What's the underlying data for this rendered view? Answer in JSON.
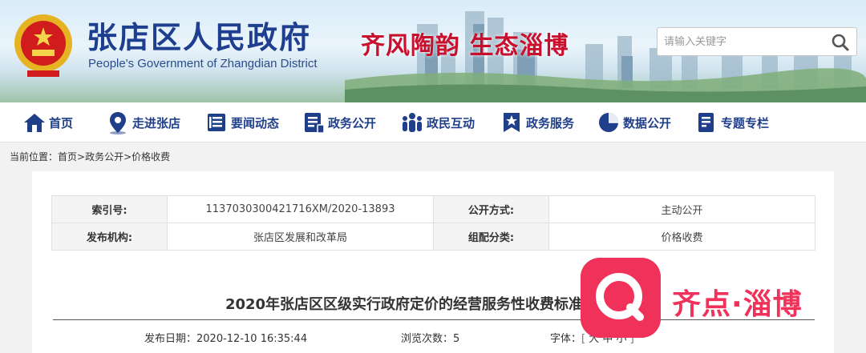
{
  "header": {
    "site_title": "张店区人民政府",
    "site_subtitle": "People's Government of Zhangdian District",
    "slogan": "齐风陶韵  生态淄博",
    "search_placeholder": "请输入关键字",
    "emblem_icon": "national-emblem-icon",
    "search_icon": "magnifier-icon"
  },
  "nav": {
    "items": [
      {
        "label": "首页",
        "icon": "home-icon"
      },
      {
        "label": "走进张店",
        "icon": "location-pin-icon"
      },
      {
        "label": "要闻动态",
        "icon": "news-icon"
      },
      {
        "label": "政务公开",
        "icon": "document-icon"
      },
      {
        "label": "政民互动",
        "icon": "people-icon"
      },
      {
        "label": "政务服务",
        "icon": "star-badge-icon"
      },
      {
        "label": "数据公开",
        "icon": "pie-chart-icon"
      },
      {
        "label": "专题专栏",
        "icon": "topic-icon"
      }
    ],
    "color": "#1f3f8a"
  },
  "breadcrumb": {
    "prefix": "当前位置：",
    "items": [
      "首页",
      "政务公开",
      "价格收费"
    ],
    "sep": ">"
  },
  "meta": {
    "index_label": "索引号:",
    "index_value": "1137030300421716XM/2020-13893",
    "mode_label": "公开方式:",
    "mode_value": "主动公开",
    "org_label": "发布机构:",
    "org_value": "张店区发展和改革局",
    "cat_label": "组配分类:",
    "cat_value": "价格收费"
  },
  "article": {
    "title": "2020年张店区区级实行政府定价的经营服务性收费标准目录清单",
    "date_label": "发布日期：",
    "date_value": "2020-12-10 16:35:44",
    "views_label": "浏览次数：",
    "views_value": "5",
    "font_label": "字体：",
    "font_open": "[",
    "font_large": "大",
    "font_medium": "中",
    "font_small": "小",
    "font_close": "]"
  },
  "watermark": {
    "text": "齐点·淄博",
    "color": "#f0325a"
  }
}
